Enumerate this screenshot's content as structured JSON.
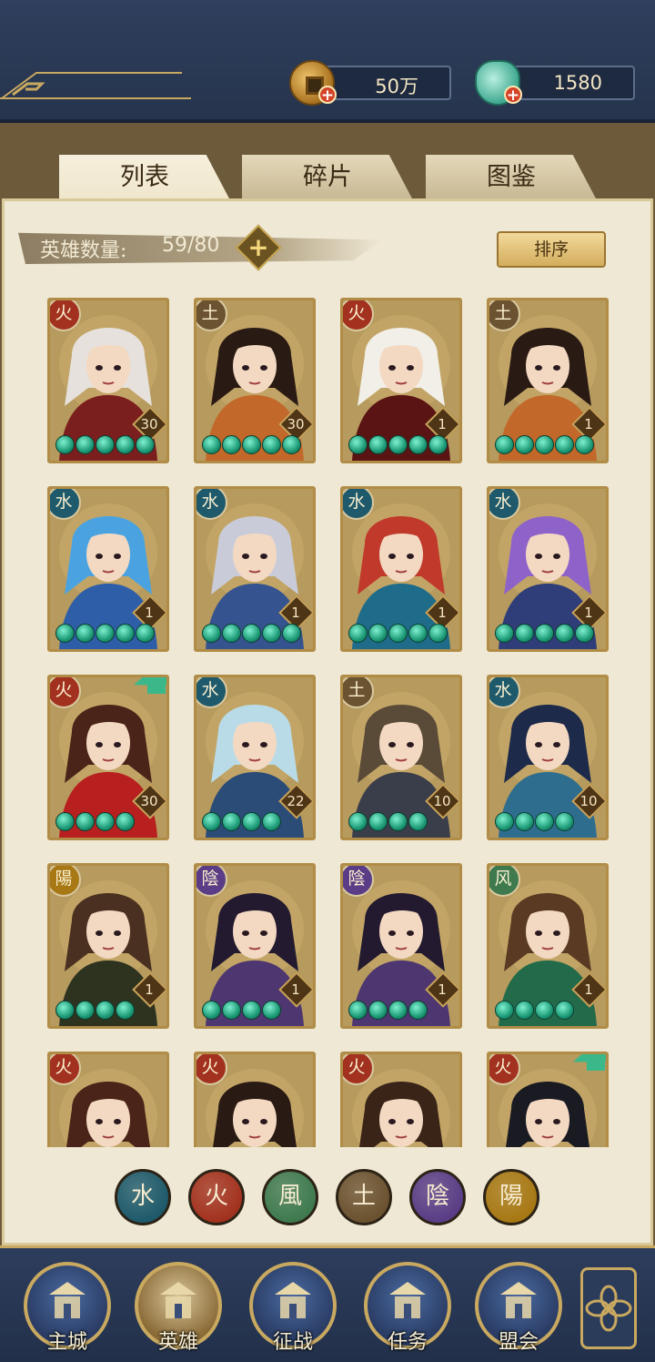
{
  "resources": {
    "coin": {
      "value": "50万",
      "icon": "copper-coin-icon"
    },
    "jade": {
      "value": "1580",
      "icon": "jade-pouch-icon"
    }
  },
  "tabs": [
    {
      "label": "列表",
      "active": true
    },
    {
      "label": "碎片",
      "active": false
    },
    {
      "label": "图鉴",
      "active": false
    }
  ],
  "hero_count": {
    "label": "英雄数量:",
    "value": "59/80"
  },
  "sort_label": "排序",
  "element_colors": {
    "火": "#a2321f",
    "土": "#6b5230",
    "水": "#1e5a6b",
    "风": "#3f7a4f",
    "陰": "#5a3d86",
    "陽": "#a77814"
  },
  "heroes": [
    {
      "element": "火",
      "level": "30",
      "stars": 5,
      "upgrade": false,
      "hair": "#e6e1dc",
      "cloth": "#7b1e1e"
    },
    {
      "element": "土",
      "level": "30",
      "stars": 5,
      "upgrade": false,
      "hair": "#2a1a14",
      "cloth": "#c2682a"
    },
    {
      "element": "火",
      "level": "1",
      "stars": 5,
      "upgrade": false,
      "hair": "#f1efe8",
      "cloth": "#5a1414"
    },
    {
      "element": "土",
      "level": "1",
      "stars": 5,
      "upgrade": false,
      "hair": "#2a1a14",
      "cloth": "#c2682a"
    },
    {
      "element": "水",
      "level": "1",
      "stars": 5,
      "upgrade": false,
      "hair": "#4aa3e0",
      "cloth": "#2f5ea8"
    },
    {
      "element": "水",
      "level": "1",
      "stars": 5,
      "upgrade": false,
      "hair": "#c9ccd8",
      "cloth": "#35548f"
    },
    {
      "element": "水",
      "level": "1",
      "stars": 5,
      "upgrade": false,
      "hair": "#c0392b",
      "cloth": "#1f6c8a"
    },
    {
      "element": "水",
      "level": "1",
      "stars": 5,
      "upgrade": false,
      "hair": "#8e63c9",
      "cloth": "#2f3d78"
    },
    {
      "element": "火",
      "level": "30",
      "stars": 4,
      "upgrade": true,
      "hair": "#4a2418",
      "cloth": "#b81f1f"
    },
    {
      "element": "水",
      "level": "22",
      "stars": 4,
      "upgrade": false,
      "hair": "#b9dbe8",
      "cloth": "#2c4c78"
    },
    {
      "element": "土",
      "level": "10",
      "stars": 4,
      "upgrade": false,
      "hair": "#5a4a38",
      "cloth": "#3a3e4a"
    },
    {
      "element": "水",
      "level": "10",
      "stars": 4,
      "upgrade": false,
      "hair": "#1d2a4a",
      "cloth": "#2f6d8f"
    },
    {
      "element": "陽",
      "level": "1",
      "stars": 4,
      "upgrade": false,
      "hair": "#4a3020",
      "cloth": "#2e3320"
    },
    {
      "element": "陰",
      "level": "1",
      "stars": 4,
      "upgrade": false,
      "hair": "#231a30",
      "cloth": "#4e3670"
    },
    {
      "element": "陰",
      "level": "1",
      "stars": 4,
      "upgrade": false,
      "hair": "#231a30",
      "cloth": "#4e3670"
    },
    {
      "element": "风",
      "level": "1",
      "stars": 4,
      "upgrade": false,
      "hair": "#5a3a22",
      "cloth": "#236a4a"
    },
    {
      "element": "火",
      "level": "",
      "stars": 0,
      "upgrade": false,
      "hair": "#4a2418",
      "cloth": "#8a2a1a"
    },
    {
      "element": "火",
      "level": "",
      "stars": 0,
      "upgrade": false,
      "hair": "#2a1a14",
      "cloth": "#b01f1f"
    },
    {
      "element": "火",
      "level": "",
      "stars": 0,
      "upgrade": false,
      "hair": "#3a2418",
      "cloth": "#7a3020"
    },
    {
      "element": "火",
      "level": "",
      "stars": 0,
      "upgrade": true,
      "hair": "#1a1a22",
      "cloth": "#e8e4dc"
    }
  ],
  "element_filters": [
    {
      "label": "水",
      "color": "#1e5a6b"
    },
    {
      "label": "火",
      "color": "#a2321f"
    },
    {
      "label": "風",
      "color": "#3f7a4f"
    },
    {
      "label": "土",
      "color": "#6b5230"
    },
    {
      "label": "陰",
      "color": "#5a3d86"
    },
    {
      "label": "陽",
      "color": "#a77814"
    }
  ],
  "nav": [
    {
      "label": "主城",
      "icon": "palace-icon",
      "active": false
    },
    {
      "label": "英雄",
      "icon": "hero-portrait-icon",
      "active": true
    },
    {
      "label": "征战",
      "icon": "drum-icon",
      "active": false
    },
    {
      "label": "任务",
      "icon": "scroll-bell-icon",
      "active": false
    },
    {
      "label": "盟会",
      "icon": "pavilion-icon",
      "active": false
    }
  ],
  "menu_icon": "four-petal-menu-icon"
}
